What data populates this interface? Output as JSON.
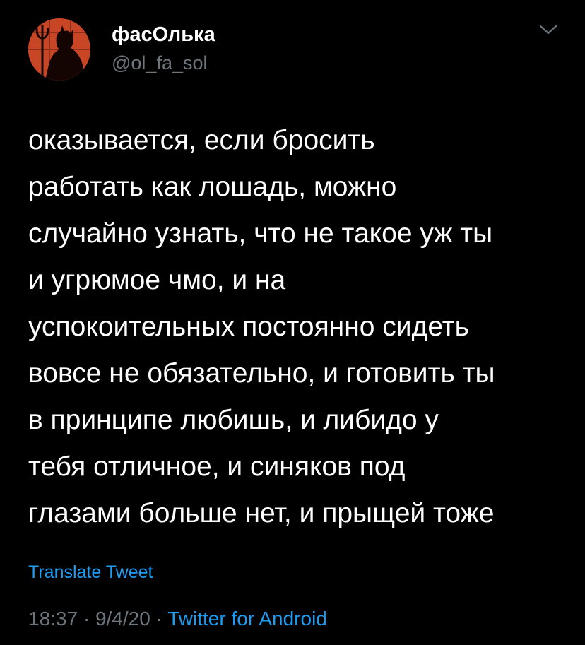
{
  "author": {
    "display_name": "фасОлька",
    "handle": "@ol_fa_sol",
    "avatar_icon": "profile-avatar-silhouette"
  },
  "menu_icon": "chevron-down-icon",
  "tweet": {
    "lines": [
      "оказывается, если бросить",
      "работать как лошадь, можно",
      "случайно узнать, что не такое уж ты",
      "и угрюмое чмо, и на",
      "успокоительных постоянно сидеть",
      "вовсе не обязательно, и готовить ты",
      "в принципе любишь, и либидо у",
      "тебя отличное, и синяков под",
      "глазами больше нет, и прыщей тоже"
    ]
  },
  "translate_label": "Translate Tweet",
  "meta": {
    "time": "18:37",
    "separator": "·",
    "date": "9/4/20",
    "source": "Twitter for Android"
  },
  "colors": {
    "background": "#000000",
    "text": "#ffffff",
    "secondary": "#6e767d",
    "link": "#1d9bf0",
    "avatar_bg": "#c84526"
  }
}
